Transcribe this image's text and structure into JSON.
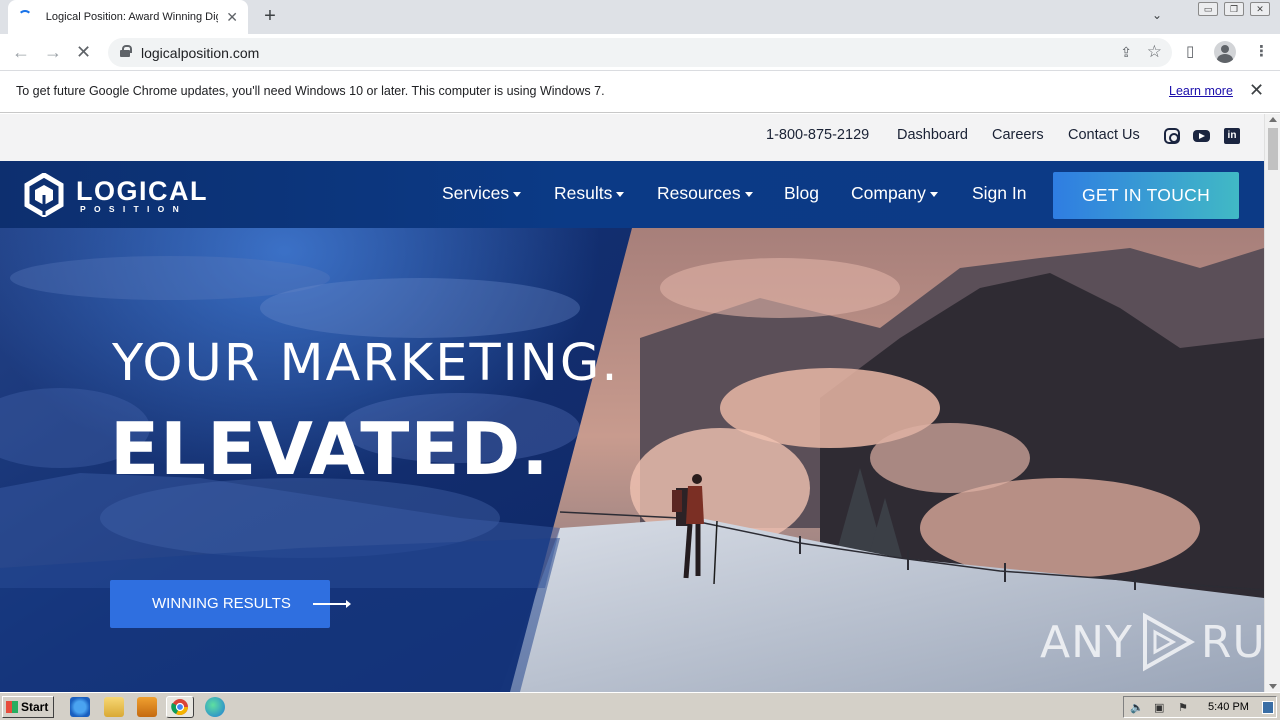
{
  "browser": {
    "tab_title": "Logical Position: Award Winning Digit",
    "tab_close": "✕",
    "new_tab": "+",
    "url": "logicalposition.com",
    "window_controls": [
      "▭",
      "❐",
      "✕"
    ]
  },
  "infobar": {
    "message": "To get future Google Chrome updates, you'll need Windows 10 or later. This computer is using Windows 7.",
    "link": "Learn more",
    "close": "✕"
  },
  "utility_nav": {
    "phone": "1-800-875-2129",
    "links": [
      "Dashboard",
      "Careers",
      "Contact Us"
    ],
    "social_icons": [
      "instagram-icon",
      "youtube-icon",
      "linkedin-icon"
    ],
    "linkedin_glyph": "in"
  },
  "brand": {
    "name": "LOGICAL",
    "sub": "POSITION"
  },
  "main_nav": {
    "items": [
      "Services",
      "Results",
      "Resources",
      "Blog",
      "Company",
      "Sign In"
    ],
    "cta": "GET IN TOUCH"
  },
  "hero": {
    "line1": "YOUR MARKETING.",
    "line2": "ELEVATED.",
    "button": "WINNING RESULTS"
  },
  "watermark": {
    "left": "ANY",
    "right": "RUN"
  },
  "taskbar": {
    "start": "Start",
    "clock": "5:40 PM"
  },
  "colors": {
    "nav_bg": "#0b3a86",
    "cta_gradient_start": "#2f7de2",
    "cta_gradient_end": "#41b9c5",
    "hero_button": "#2f6fe0"
  }
}
